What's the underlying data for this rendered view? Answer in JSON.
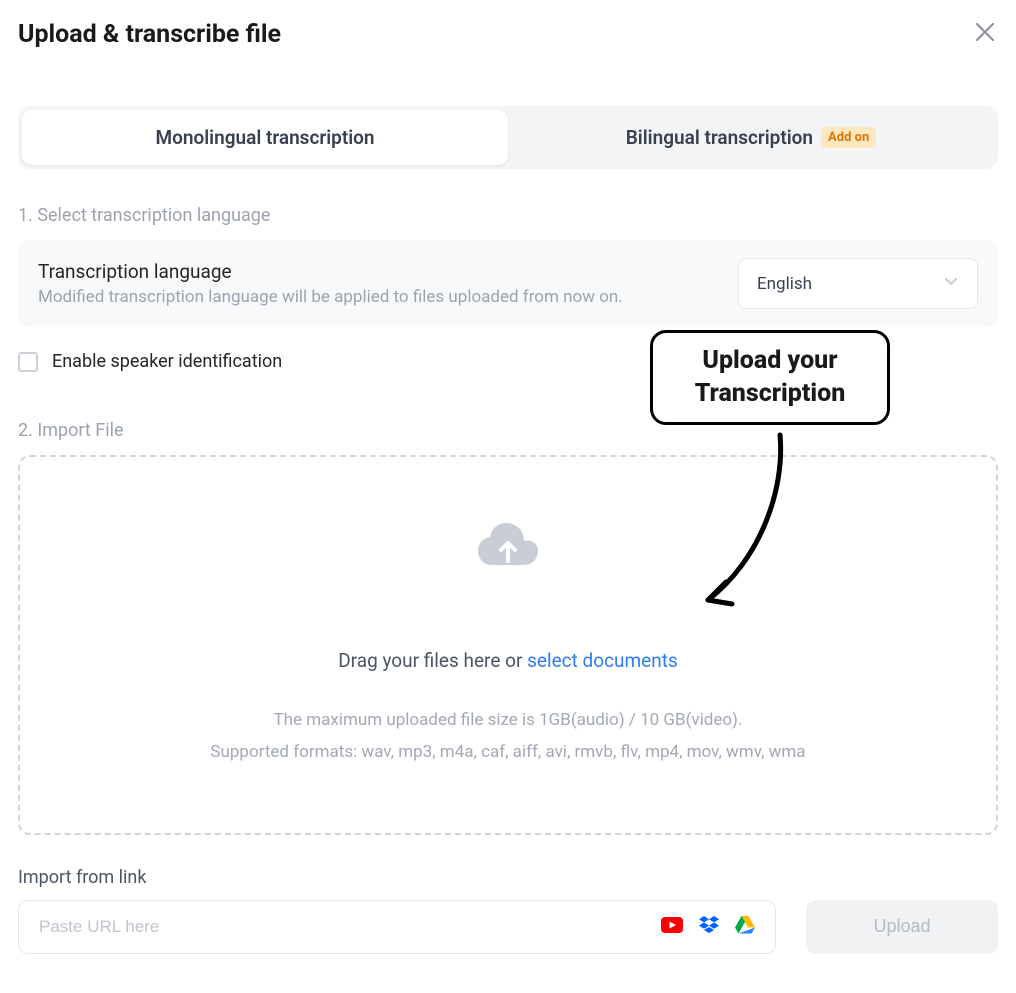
{
  "header": {
    "title": "Upload & transcribe file"
  },
  "tabs": {
    "monolingual": "Monolingual transcription",
    "bilingual": "Bilingual transcription",
    "addon": "Add on"
  },
  "section1": {
    "label": "1. Select transcription language",
    "lang_title": "Transcription language",
    "lang_sub": "Modified transcription language will be applied to files uploaded from now on.",
    "selected_language": "English",
    "checkbox_label": "Enable speaker identification"
  },
  "section2": {
    "label": "2. Import File",
    "drag_text": "Drag your files here or ",
    "select_link": "select documents",
    "hint_size": "The maximum uploaded file size is 1GB(audio) / 10 GB(video).",
    "hint_formats": "Supported formats: wav, mp3, m4a, caf, aiff, avi, rmvb, flv, mp4, mov, wmv, wma"
  },
  "import_link": {
    "label": "Import from link",
    "placeholder": "Paste URL here"
  },
  "upload_button": "Upload",
  "callout": {
    "line1": "Upload your",
    "line2": "Transcription"
  }
}
